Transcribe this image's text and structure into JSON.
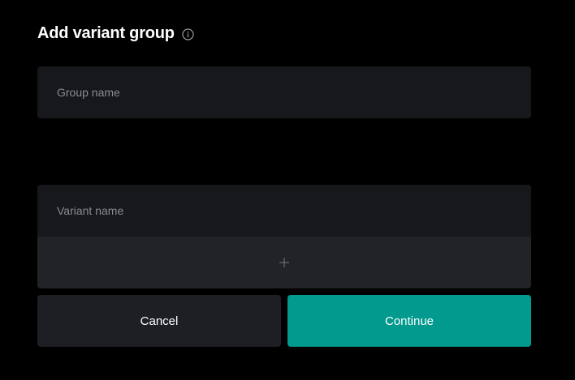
{
  "dialog": {
    "title": "Add variant group",
    "info_icon": "info-icon"
  },
  "group_name": {
    "placeholder": "Group name",
    "value": ""
  },
  "variant": {
    "placeholder": "Variant name",
    "value": "",
    "add_icon": "plus-icon"
  },
  "actions": {
    "cancel_label": "Cancel",
    "continue_label": "Continue"
  },
  "colors": {
    "background": "#000000",
    "field": "#17181c",
    "add_row": "#222327",
    "cancel": "#1e1f24",
    "accent": "#029a8f"
  }
}
